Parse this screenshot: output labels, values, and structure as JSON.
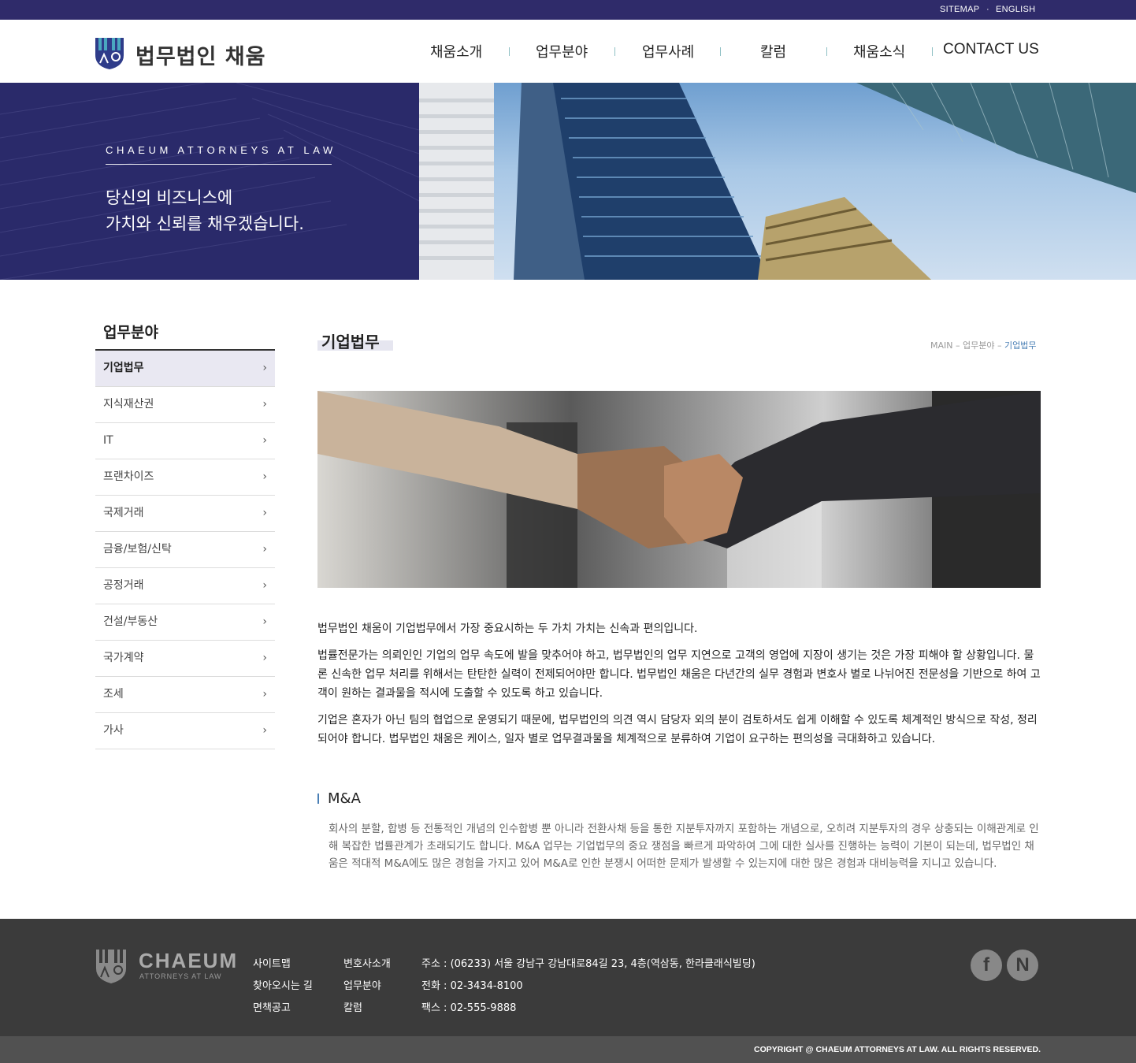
{
  "topbar": {
    "sitemap": "SITEMAP",
    "english": "ENGLISH",
    "dot": "·"
  },
  "header": {
    "logo_text": "법무법인 채움",
    "nav": [
      "채움소개",
      "업무분야",
      "업무사례",
      "칼럼",
      "채움소식",
      "CONTACT US"
    ]
  },
  "hero": {
    "tagline": "CHAEUM ATTORNEYS AT LAW",
    "line1": "당신의 비즈니스에",
    "line2": "가치와 신뢰를 채우겠습니다."
  },
  "sidebar": {
    "title": "업무분야",
    "items": [
      "기업법무",
      "지식재산권",
      "IT",
      "프랜차이즈",
      "국제거래",
      "금융/보험/신탁",
      "공정거래",
      "건설/부동산",
      "국가계약",
      "조세",
      "가사"
    ],
    "active_index": 0,
    "chevron": "›"
  },
  "content": {
    "title": "기업법무",
    "breadcrumb": {
      "main": "MAIN",
      "sep": "–",
      "section": "업무분야",
      "current": "기업법무"
    },
    "p1": "법무법인 채움이 기업법무에서 가장 중요시하는 두 가치 가치는 신속과 편의입니다.",
    "p2": "법률전문가는 의뢰인인 기업의 업무 속도에 발을 맞추어야 하고, 법무법인의 업무 지연으로 고객의 영업에 지장이 생기는 것은 가장 피해야 할 상황입니다. 물론 신속한 업무 처리를 위해서는 탄탄한 실력이 전제되어야만 합니다. 법무법인 채움은 다년간의 실무 경험과 변호사 별로 나뉘어진 전문성을 기반으로 하여 고객이 원하는 결과물을 적시에 도출할 수 있도록 하고 있습니다.",
    "p3": "기업은 혼자가 아닌 팀의 협업으로 운영되기 때문에, 법무법인의 의견 역시 담당자 외의 분이 검토하셔도 쉽게 이해할 수 있도록 체계적인 방식으로 작성, 정리되어야 합니다. 법무법인 채움은 케이스, 일자 별로 업무결과물을 체계적으로 분류하여 기업이 요구하는 편의성을 극대화하고 있습니다.",
    "ma_title": "M&A",
    "ma_text": "회사의 분할, 합병 등 전통적인 개념의 인수합병 뿐 아니라 전환사채 등을 통한 지분투자까지 포함하는 개념으로, 오히려 지분투자의 경우 상충되는 이해관계로 인해 복잡한 법률관계가 초래되기도 합니다. M&A 업무는 기업법무의 중요 쟁점을 빠르게 파악하여 그에 대한 실사를 진행하는 능력이 기본이 되는데, 법무법인 채움은 적대적 M&A에도 많은 경험을 가지고 있어 M&A로 인한 분쟁시 어떠한 문제가 발생할 수 있는지에 대한 많은 경험과 대비능력을 지니고 있습니다."
  },
  "footer": {
    "logo_text": "CHAEUM",
    "logo_sub": "ATTORNEYS AT LAW",
    "links_col1": [
      "사이트맵",
      "찾아오시는 길",
      "면책공고"
    ],
    "links_col2": [
      "변호사소개",
      "업무분야",
      "칼럼"
    ],
    "address": "주소 : (06233) 서울 강남구 강남대로84길 23, 4층(역삼동, 한라클래식빌딩)",
    "phone": "전화 : 02-3434-8100",
    "fax": "팩스 : 02-555-9888",
    "sns": [
      "f",
      "N"
    ],
    "copyright": "COPYRIGHT @ CHAEUM ATTORNEYS AT LAW. ALL RIGHTS RESERVED."
  },
  "colors": {
    "brand_navy": "#2f2b6a",
    "accent_blue": "#4a7fb5",
    "footer_bg": "#3b3b3b"
  }
}
